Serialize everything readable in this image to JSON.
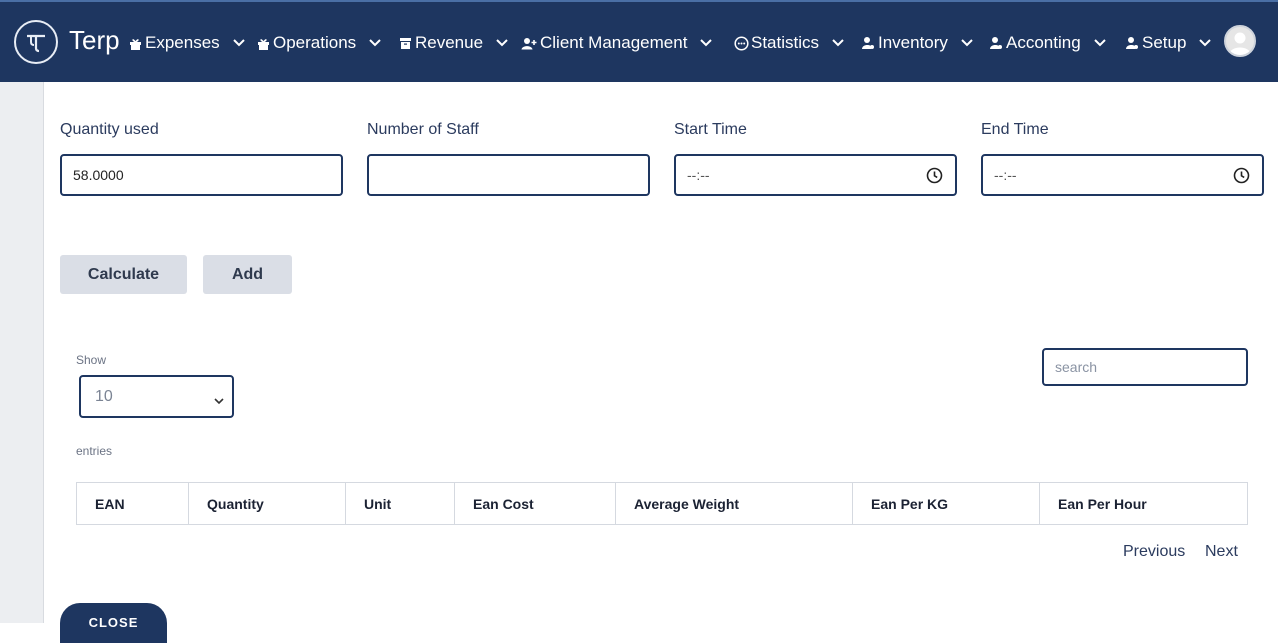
{
  "brand": {
    "name": "Terp"
  },
  "nav": [
    {
      "label": "Expenses",
      "icon": "gift-icon"
    },
    {
      "label": "Operations",
      "icon": "gift-icon"
    },
    {
      "label": "Revenue",
      "icon": "archive-icon"
    },
    {
      "label": "Client Management",
      "icon": "users-icon"
    },
    {
      "label": "Statistics",
      "icon": "dots-circle-icon"
    },
    {
      "label": "Inventory",
      "icon": "user-gear-icon"
    },
    {
      "label": "Acconting",
      "icon": "user-gear-icon"
    },
    {
      "label": "Setup",
      "icon": "user-gear-icon"
    }
  ],
  "form": {
    "quantity_used": {
      "label": "Quantity used",
      "value": "58.0000"
    },
    "number_of_staff": {
      "label": "Number of Staff",
      "value": ""
    },
    "start_time": {
      "label": "Start Time",
      "value": "--:--"
    },
    "end_time": {
      "label": "End Time",
      "value": "--:--"
    }
  },
  "buttons": {
    "calculate": "Calculate",
    "add": "Add",
    "close": "CLOSE"
  },
  "table_controls": {
    "show_label": "Show",
    "page_size": "10",
    "entries_label": "entries",
    "search_placeholder": "search"
  },
  "table": {
    "columns": [
      "EAN",
      "Quantity",
      "Unit",
      "Ean Cost",
      "Average Weight",
      "Ean Per KG",
      "Ean Per Hour"
    ]
  },
  "pagination": {
    "previous": "Previous",
    "next": "Next"
  },
  "colors": {
    "navbar": "#1e3660",
    "accent_border": "#1e3660",
    "button_grey": "#dadee6"
  }
}
